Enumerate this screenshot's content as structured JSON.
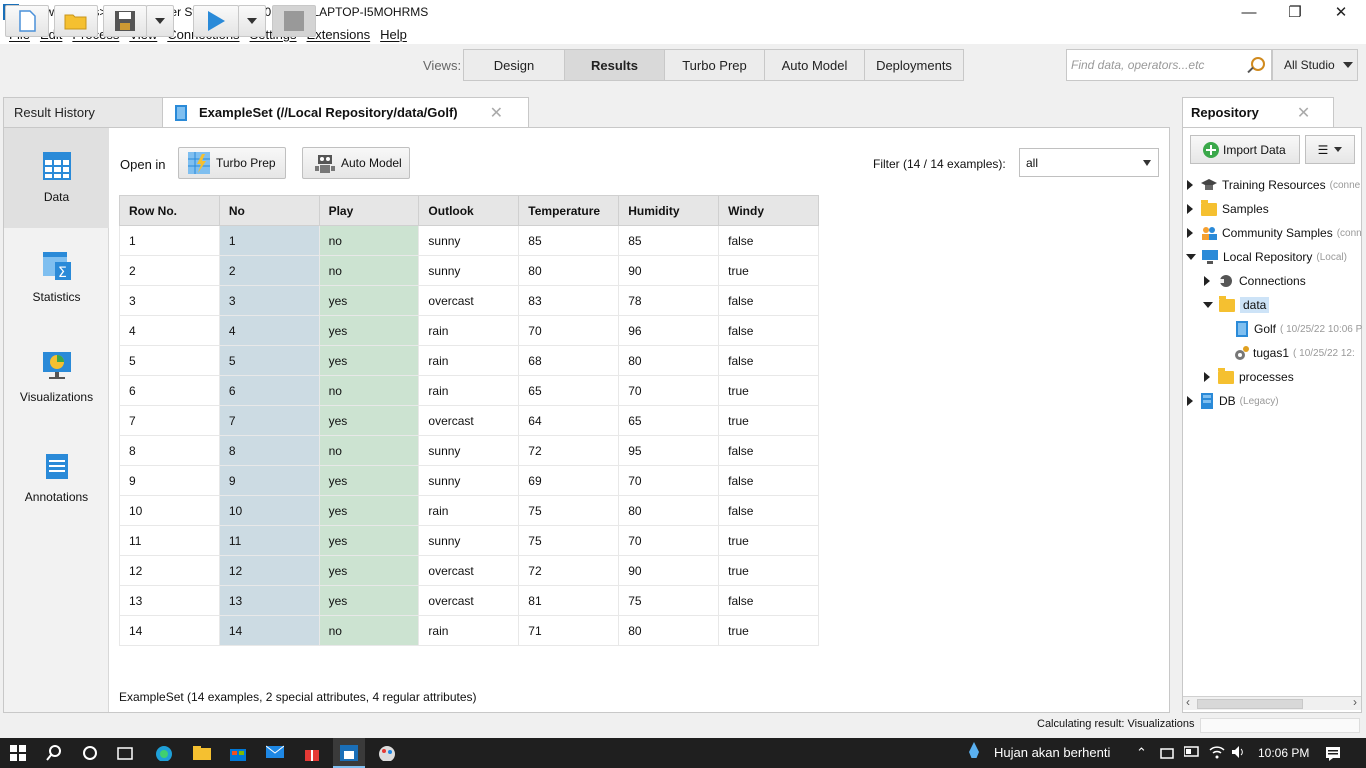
{
  "window": {
    "title": "<new process> – RapidMiner Studio Trial 9.10.011 @ LAPTOP-I5MOHRMS"
  },
  "menu": [
    "File",
    "Edit",
    "Process",
    "View",
    "Connections",
    "Settings",
    "Extensions",
    "Help"
  ],
  "views": {
    "label": "Views:",
    "tabs": [
      "Design",
      "Results",
      "Turbo Prep",
      "Auto Model",
      "Deployments"
    ],
    "active": "Results"
  },
  "search": {
    "placeholder": "Find data, operators...etc"
  },
  "studio_mode": "All Studio",
  "tabs": {
    "history": "Result History",
    "exampleset": "ExampleSet (//Local Repository/data/Golf)"
  },
  "sidebar": [
    "Data",
    "Statistics",
    "Visualizations",
    "Annotations"
  ],
  "open_in": {
    "label": "Open in",
    "turbo_prep": "Turbo Prep",
    "auto_model": "Auto Model"
  },
  "filter": {
    "label": "Filter (14 / 14 examples):",
    "value": "all"
  },
  "table": {
    "headers": [
      "Row No.",
      "No",
      "Play",
      "Outlook",
      "Temperature",
      "Humidity",
      "Windy"
    ],
    "rows": [
      [
        "1",
        "1",
        "no",
        "sunny",
        "85",
        "85",
        "false"
      ],
      [
        "2",
        "2",
        "no",
        "sunny",
        "80",
        "90",
        "true"
      ],
      [
        "3",
        "3",
        "yes",
        "overcast",
        "83",
        "78",
        "false"
      ],
      [
        "4",
        "4",
        "yes",
        "rain",
        "70",
        "96",
        "false"
      ],
      [
        "5",
        "5",
        "yes",
        "rain",
        "68",
        "80",
        "false"
      ],
      [
        "6",
        "6",
        "no",
        "rain",
        "65",
        "70",
        "true"
      ],
      [
        "7",
        "7",
        "yes",
        "overcast",
        "64",
        "65",
        "true"
      ],
      [
        "8",
        "8",
        "no",
        "sunny",
        "72",
        "95",
        "false"
      ],
      [
        "9",
        "9",
        "yes",
        "sunny",
        "69",
        "70",
        "false"
      ],
      [
        "10",
        "10",
        "yes",
        "rain",
        "75",
        "80",
        "false"
      ],
      [
        "11",
        "11",
        "yes",
        "sunny",
        "75",
        "70",
        "true"
      ],
      [
        "12",
        "12",
        "yes",
        "overcast",
        "72",
        "90",
        "true"
      ],
      [
        "13",
        "13",
        "yes",
        "overcast",
        "81",
        "75",
        "false"
      ],
      [
        "14",
        "14",
        "no",
        "rain",
        "71",
        "80",
        "true"
      ]
    ]
  },
  "footer": "ExampleSet (14 examples, 2 special attributes, 4 regular attributes)",
  "repository": {
    "title": "Repository",
    "import": "Import Data",
    "items": {
      "training": "Training Resources",
      "training_sub": "(conne",
      "samples": "Samples",
      "community": "Community Samples",
      "community_sub": "(conn",
      "local": "Local Repository",
      "local_sub": "(Local)",
      "connections": "Connections",
      "data": "data",
      "golf": "Golf",
      "golf_sub": "( 10/25/22 10:06 P",
      "tugas1": "tugas1",
      "tugas1_sub": "( 10/25/22 12:",
      "processes": "processes",
      "db": "DB",
      "db_sub": "(Legacy)"
    }
  },
  "status": "Calculating result: Visualizations",
  "taskbar": {
    "weather": "Hujan akan berhenti",
    "time": "10:06 PM"
  }
}
